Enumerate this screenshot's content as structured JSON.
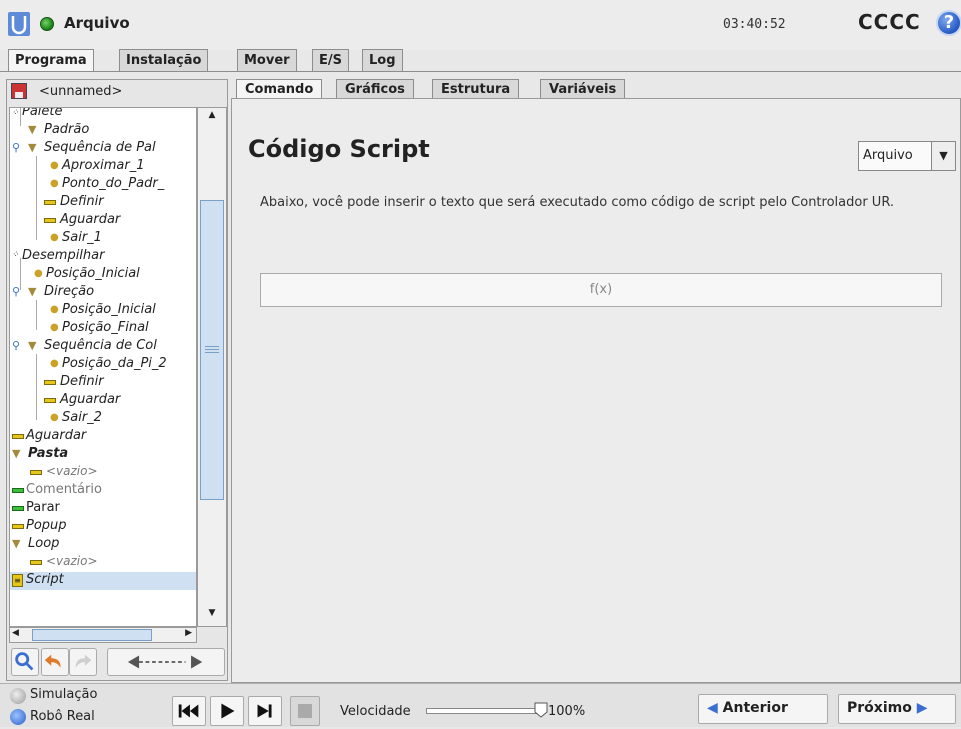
{
  "header": {
    "file_menu": "Arquivo",
    "time": "03:40:52",
    "robot_name": "CCCC",
    "help": "?"
  },
  "main_tabs": [
    "Programa",
    "Instalação",
    "Mover",
    "E/S",
    "Log"
  ],
  "left_panel": {
    "program_name": "<unnamed>",
    "tree": [
      {
        "label": "Palete",
        "icon": "pallet-icon"
      },
      {
        "label": "Padrão",
        "icon": "triangle-icon"
      },
      {
        "label": "Sequência de Pal",
        "icon": "triangle-icon"
      },
      {
        "label": "Aproximar_1",
        "icon": "waypoint-icon"
      },
      {
        "label": "Ponto_do_Padr_",
        "icon": "waypoint-icon"
      },
      {
        "label": "Definir",
        "icon": "bar-icon"
      },
      {
        "label": "Aguardar",
        "icon": "bar-icon"
      },
      {
        "label": "Sair_1",
        "icon": "waypoint-icon"
      },
      {
        "label": "Desempilhar",
        "icon": "pallet-icon"
      },
      {
        "label": "Posição_Inicial",
        "icon": "waypoint-icon"
      },
      {
        "label": "Direção",
        "icon": "triangle-icon"
      },
      {
        "label": "Posição_Inicial",
        "icon": "waypoint-icon"
      },
      {
        "label": "Posição_Final",
        "icon": "waypoint-icon"
      },
      {
        "label": "Sequência de Col",
        "icon": "triangle-icon"
      },
      {
        "label": "Posição_da_Pi_2",
        "icon": "waypoint-icon"
      },
      {
        "label": "Definir",
        "icon": "bar-icon"
      },
      {
        "label": "Aguardar",
        "icon": "bar-icon"
      },
      {
        "label": "Sair_2",
        "icon": "waypoint-icon"
      },
      {
        "label": "Aguardar",
        "icon": "bar-icon"
      },
      {
        "label": "Pasta",
        "icon": "triangle-icon"
      },
      {
        "label": "<vazio>",
        "icon": "bar-icon"
      },
      {
        "label": "Comentário",
        "icon": "bar-icon"
      },
      {
        "label": "Parar",
        "icon": "bar-icon"
      },
      {
        "label": "Popup",
        "icon": "bar-icon"
      },
      {
        "label": "Loop",
        "icon": "triangle-icon"
      },
      {
        "label": "<vazio>",
        "icon": "bar-icon"
      },
      {
        "label": "Script",
        "icon": "script-icon"
      }
    ]
  },
  "sub_tabs": [
    "Comando",
    "Gráficos",
    "Estrutura",
    "Variáveis"
  ],
  "content": {
    "title": "Código Script",
    "mode_select": "Arquivo",
    "description": "Abaixo, você pode inserir o texto que será executado como código de script pelo Controlador UR.",
    "script_placeholder": "f(x)"
  },
  "footer": {
    "simulation": "Simulação",
    "real_robot": "Robô Real",
    "speed_label": "Velocidade",
    "speed_value": "100%",
    "speed_fraction": 1.0,
    "prev": "Anterior",
    "next": "Próximo"
  },
  "colors": {
    "accent_blue": "#3a6fd1",
    "bar_yellow": "#e6c619",
    "triangle_brown": "#a58a3c",
    "green": "#3dbf3d"
  }
}
